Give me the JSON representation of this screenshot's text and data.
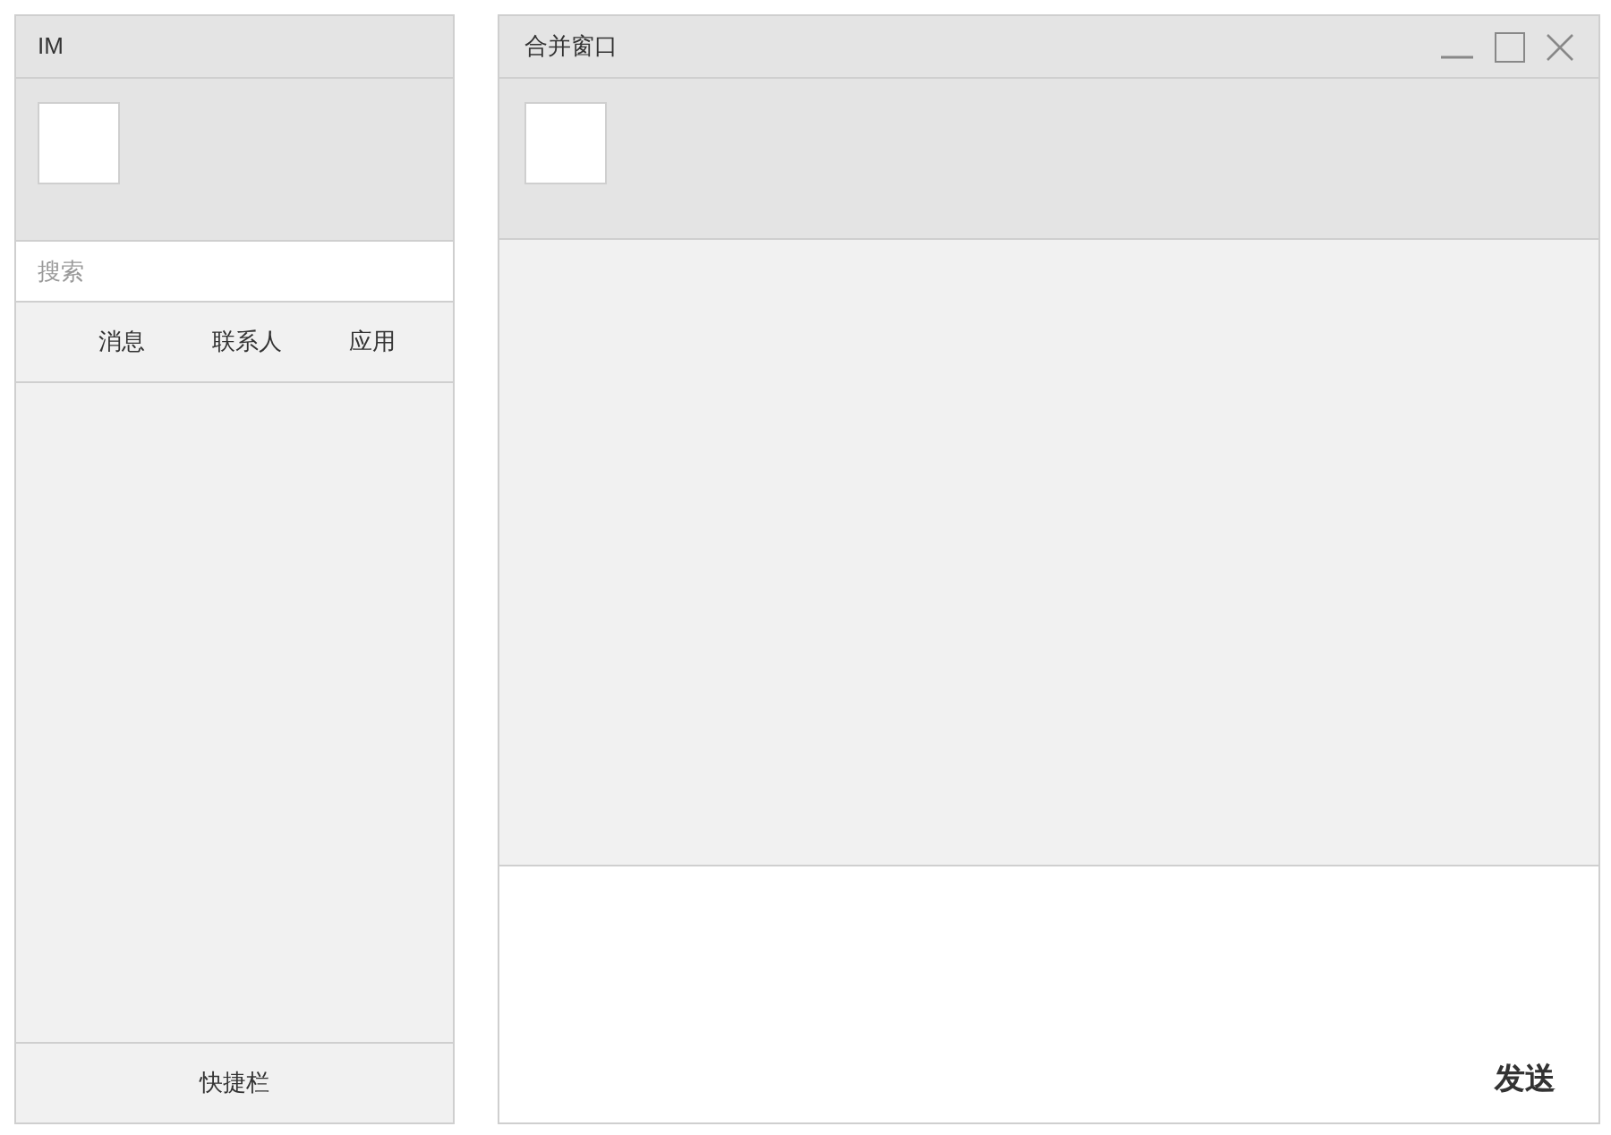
{
  "main_window": {
    "title": "IM",
    "search": {
      "placeholder": "搜索"
    },
    "tabs": [
      "消息",
      "联系人",
      "应用"
    ],
    "footer": "快捷栏"
  },
  "chat_window": {
    "title": "合并窗口",
    "send_button": "发送"
  }
}
